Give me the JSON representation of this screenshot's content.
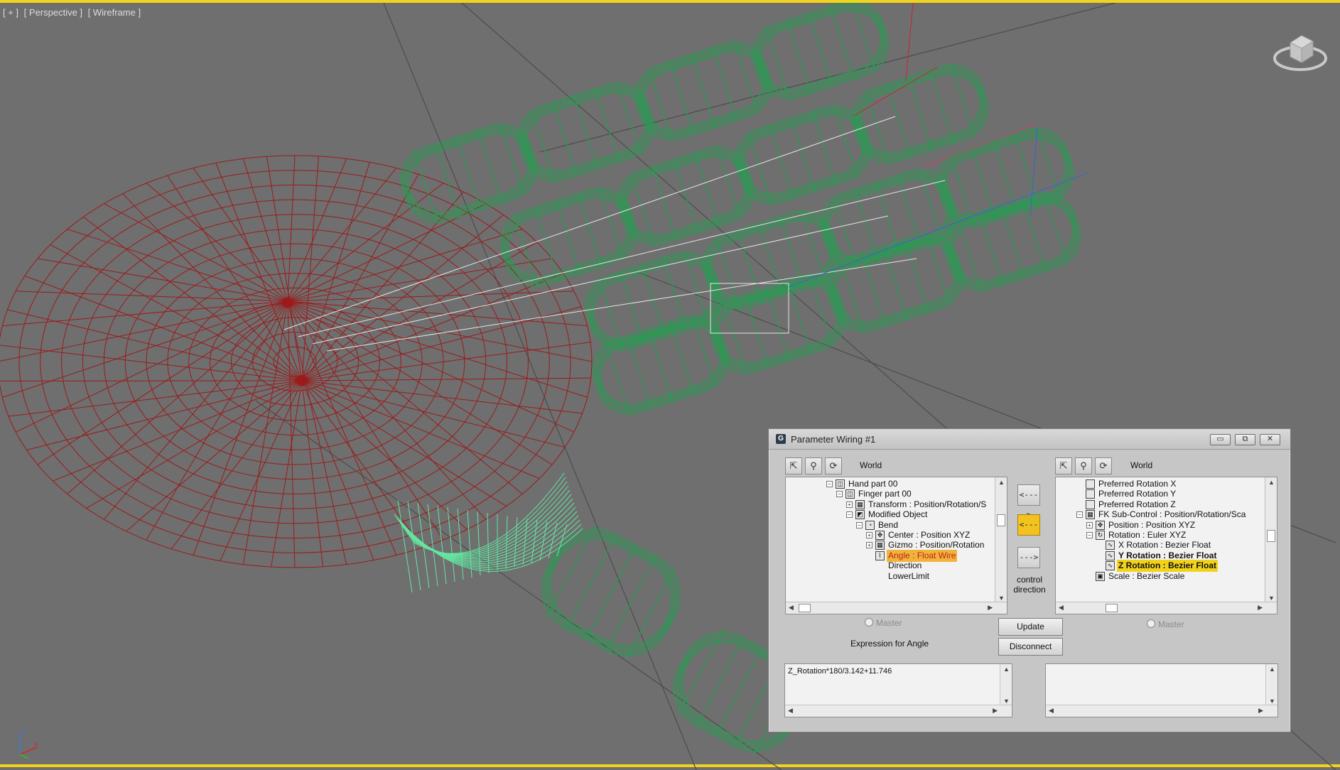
{
  "viewport": {
    "labels": [
      "[ + ]",
      "[ Perspective ]",
      "[ Wireframe ]"
    ]
  },
  "dialog": {
    "title": "Parameter Wiring #1",
    "app_icon": "G",
    "window_buttons": {
      "minimize": "▭",
      "restore": "⧉",
      "close": "✕"
    },
    "left": {
      "world_label": "World",
      "tree": [
        {
          "label": "Hand part 00",
          "indent": 5,
          "icon": "box-icon",
          "expand": "−"
        },
        {
          "label": "Finger part 00",
          "indent": 6,
          "icon": "box-icon",
          "expand": "−"
        },
        {
          "label": "Transform : Position/Rotation/S",
          "indent": 7,
          "icon": "transform-icon",
          "expand": "+"
        },
        {
          "label": "Modified Object",
          "indent": 7,
          "icon": "modifier-icon",
          "expand": "−"
        },
        {
          "label": "Bend",
          "indent": 8,
          "icon": "bend-icon",
          "expand": "−"
        },
        {
          "label": "Center : Position XYZ",
          "indent": 9,
          "icon": "position-icon",
          "expand": "+"
        },
        {
          "label": "Gizmo : Position/Rotation",
          "indent": 9,
          "icon": "transform-icon",
          "expand": "+"
        },
        {
          "label": "Angle : Float Wire",
          "indent": 9,
          "icon": "wire-icon",
          "expand": "",
          "style": "sel-orange"
        },
        {
          "label": "Direction",
          "indent": 9,
          "icon": "",
          "expand": ""
        },
        {
          "label": "LowerLimit",
          "indent": 9,
          "icon": "",
          "expand": ""
        }
      ],
      "master_label": "Master",
      "expression_label": "Expression for Angle",
      "expression_text": "Z_Rotation*180/3.142+11.746"
    },
    "right": {
      "world_label": "World",
      "tree": [
        {
          "label": "Preferred Rotation X",
          "indent": 3,
          "icon": "track-icon",
          "expand": ""
        },
        {
          "label": "Preferred Rotation Y",
          "indent": 3,
          "icon": "track-icon",
          "expand": ""
        },
        {
          "label": "Preferred Rotation Z",
          "indent": 3,
          "icon": "track-icon",
          "expand": ""
        },
        {
          "label": "FK Sub-Control : Position/Rotation/Sca",
          "indent": 3,
          "icon": "transform-icon",
          "expand": "−"
        },
        {
          "label": "Position : Position XYZ",
          "indent": 4,
          "icon": "position-icon",
          "expand": "+"
        },
        {
          "label": "Rotation : Euler XYZ",
          "indent": 4,
          "icon": "rotation-icon",
          "expand": "−"
        },
        {
          "label": "X Rotation : Bezier Float",
          "indent": 5,
          "icon": "curve-icon",
          "expand": ""
        },
        {
          "label": "Y Rotation : Bezier Float",
          "indent": 5,
          "icon": "curve-icon",
          "expand": "",
          "style": "bold"
        },
        {
          "label": "Z Rotation : Bezier Float",
          "indent": 5,
          "icon": "curve-icon",
          "expand": "",
          "style": "sel-yellow"
        },
        {
          "label": "Scale : Bezier Scale",
          "indent": 4,
          "icon": "scale-icon",
          "expand": ""
        }
      ],
      "master_label": "Master",
      "expression_text": ""
    },
    "arrows": {
      "right": "<--->",
      "left": "<---",
      "down": "--->"
    },
    "control_direction": [
      "control",
      "direction"
    ],
    "buttons": {
      "update": "Update",
      "disconnect": "Disconnect"
    }
  },
  "colors": {
    "viewport_bg": "#6f6f6f",
    "active_border": "#f2d21a",
    "sphere_wire": "#9b1b1b",
    "finger_wire": "#1fa14f",
    "selected_wire": "#63e6a0",
    "highlight_orange": "#f1b43a",
    "highlight_yellow": "#f2d31b"
  }
}
